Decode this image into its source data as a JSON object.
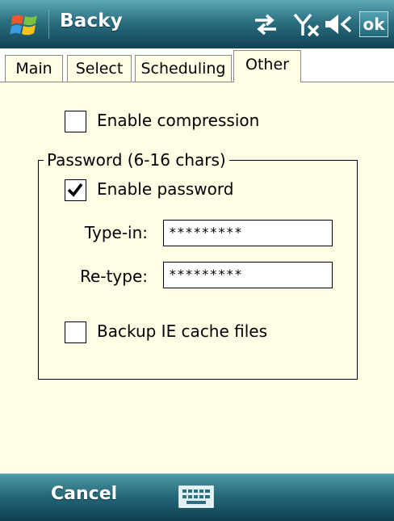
{
  "window": {
    "app_title": "Backy",
    "ok_label": "ok"
  },
  "tabs": [
    {
      "label": "Main",
      "active": false
    },
    {
      "label": "Select",
      "active": false
    },
    {
      "label": "Scheduling",
      "active": false
    },
    {
      "label": "Other",
      "active": true
    }
  ],
  "options": {
    "compression": {
      "label": "Enable compression",
      "checked": false
    },
    "password_group": {
      "legend": "Password (6-16 chars)",
      "enable": {
        "label": "Enable password",
        "checked": true
      },
      "type_in": {
        "label": "Type-in:",
        "value": "*********"
      },
      "re_type": {
        "label": "Re-type:",
        "value": "*********"
      }
    },
    "ie_cache": {
      "label": "Backup IE cache files",
      "checked": false
    }
  },
  "softkeys": {
    "left": "Cancel"
  },
  "icons": {
    "start": "windows-flag-icon",
    "connectivity": "sync-arrows-icon",
    "signal": "no-signal-icon",
    "volume": "speaker-icon",
    "keyboard": "keyboard-icon"
  },
  "colors": {
    "title_bar": "#2b6f80",
    "content_bg": "#fffde3"
  }
}
